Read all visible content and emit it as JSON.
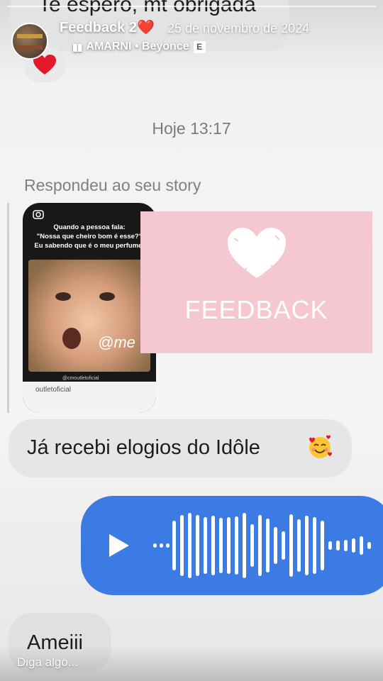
{
  "story": {
    "title": "Feedback 2",
    "title_heart": "❤️",
    "date": "25 de novembro de 2024",
    "music_icon": "music-bars-icon",
    "music": "AMARNI • Beyonce",
    "explicit": "E",
    "reply_placeholder": "Diga algo..."
  },
  "chat": {
    "top_message": "Te espero, mt obrigada",
    "reaction": "heart",
    "timestamp": "Hoje 13:17",
    "replied_label": "Respondeu ao seu story",
    "shared_story": {
      "caption_line1": "Quando a pessoa fala:",
      "caption_line2": "\"Nossa que cheiro bom é esse?\"",
      "caption_line3": "Eu sabendo que é o meu perfume:",
      "handle": "@me",
      "watermark": "@cmoutletoficial",
      "footer": "outletoficial"
    },
    "received_message": "Já recebi elogios do Idôle",
    "received_emoji": "smiling-face-with-hearts",
    "voice_message": {
      "played": false
    },
    "last_message": "Ameiii"
  },
  "overlay": {
    "sticker_text": "FEEDBACK",
    "sticker_color": "#f5c8d1"
  },
  "colors": {
    "voice_bubble": "#3d7be4",
    "received_bubble": "#e6e6e6"
  }
}
